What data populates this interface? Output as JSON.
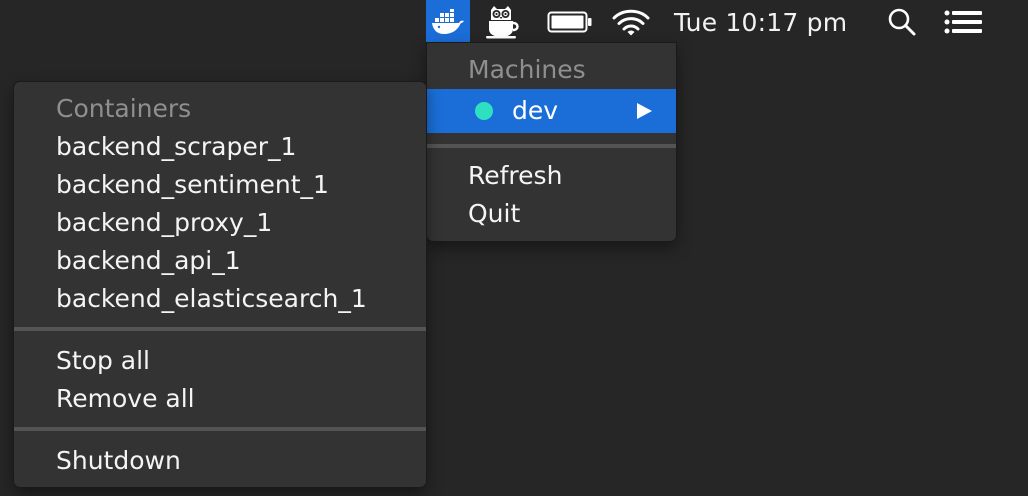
{
  "menubar": {
    "clock": "Tue 10:17 pm",
    "icons": [
      "docker-whale-icon",
      "owl-cup-icon",
      "battery-icon",
      "wifi-icon",
      "spotlight-search-icon",
      "notification-list-icon"
    ]
  },
  "machines_menu": {
    "header": "Machines",
    "machine": {
      "name": "dev",
      "status_color": "#2fe0c0"
    },
    "actions": [
      "Refresh",
      "Quit"
    ]
  },
  "containers_menu": {
    "header": "Containers",
    "containers": [
      "backend_scraper_1",
      "backend_sentiment_1",
      "backend_proxy_1",
      "backend_api_1",
      "backend_elasticsearch_1"
    ],
    "bulk_actions": [
      "Stop all",
      "Remove all"
    ],
    "shutdown": "Shutdown"
  },
  "colors": {
    "desktop": "#262626",
    "menu_bg": "#333333",
    "selection": "#1b6ed8",
    "separator": "#545454",
    "header_text": "#8f8f8f"
  }
}
